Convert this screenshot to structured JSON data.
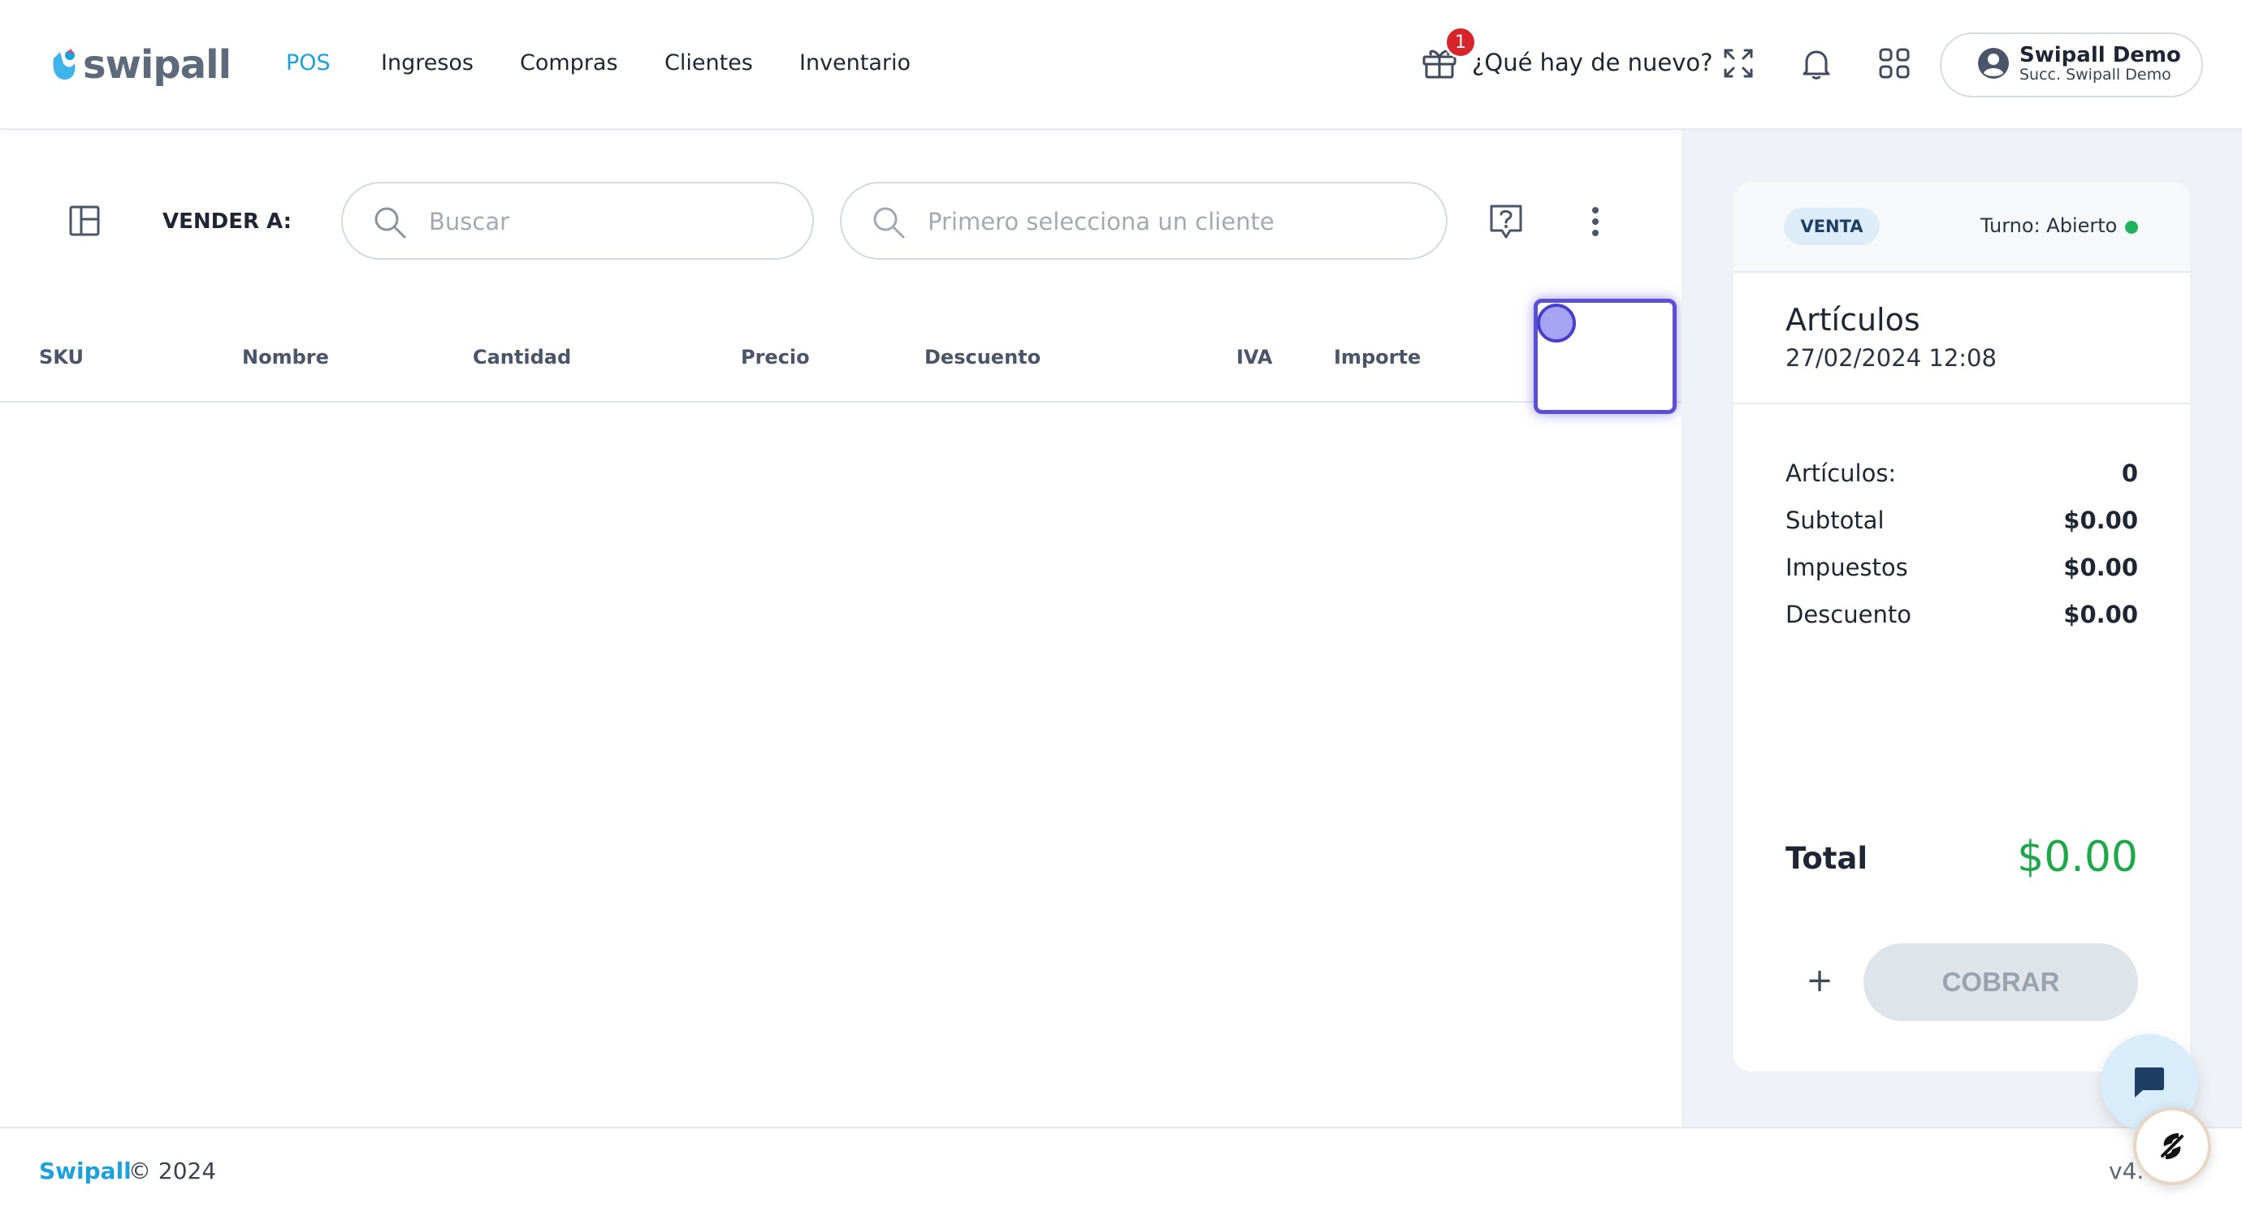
{
  "header": {
    "logo_text": "swipall",
    "nav": [
      {
        "label": "POS",
        "active": true
      },
      {
        "label": "Ingresos",
        "active": false
      },
      {
        "label": "Compras",
        "active": false
      },
      {
        "label": "Clientes",
        "active": false
      },
      {
        "label": "Inventario",
        "active": false
      }
    ],
    "news_badge": "1",
    "whats_new": "¿Qué hay de nuevo?",
    "icons": [
      "gift-icon",
      "fullscreen-icon",
      "bell-icon",
      "apps-grid-icon",
      "user-avatar-icon"
    ],
    "user": {
      "name": "Swipall Demo",
      "branch": "Succ. Swipall Demo"
    }
  },
  "toolbar": {
    "sell_to_label": "VENDER A:",
    "search_product_placeholder": "Buscar",
    "search_client_placeholder": "Primero selecciona un cliente",
    "icons": [
      "layout-toggle-icon",
      "search-icon",
      "help-question-icon",
      "more-vertical-icon"
    ]
  },
  "table": {
    "columns": [
      "SKU",
      "Nombre",
      "Cantidad",
      "Precio",
      "Descuento",
      "IVA",
      "Importe"
    ],
    "rows": []
  },
  "summary": {
    "badge": "VENTA",
    "shift": "Turno: Abierto",
    "title": "Artículos",
    "datetime": "27/02/2024 12:08",
    "lines": [
      {
        "label": "Artículos:",
        "value": "0"
      },
      {
        "label": "Subtotal",
        "value": "$0.00"
      },
      {
        "label": "Impuestos",
        "value": "$0.00"
      },
      {
        "label": "Descuento",
        "value": "$0.00"
      }
    ],
    "total_label": "Total",
    "total_value": "$0.00",
    "plus_label": "+",
    "charge_label": "COBRAR"
  },
  "footer": {
    "brand": "Swipall",
    "copyright": "© 2024",
    "version": "v4."
  },
  "colors": {
    "accent": "#1ba1dc",
    "total_green": "#1fa84b",
    "focus_ring": "#5b4fd6",
    "badge_red": "#d6262b"
  }
}
